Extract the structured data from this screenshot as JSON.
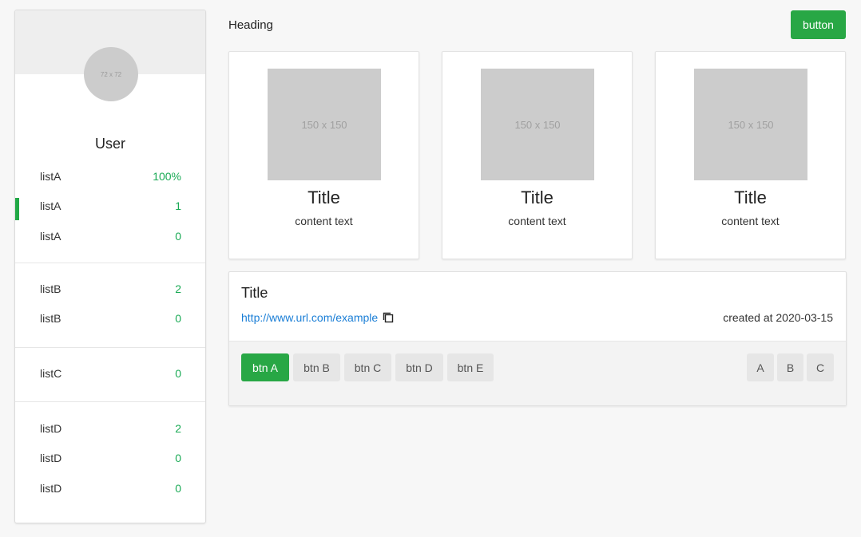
{
  "sidebar": {
    "avatar_placeholder": "72 x 72",
    "username": "User",
    "groups": [
      [
        {
          "label": "listA",
          "value": "100%"
        },
        {
          "label": "listA",
          "value": "1"
        },
        {
          "label": "listA",
          "value": "0"
        }
      ],
      [
        {
          "label": "listB",
          "value": "2"
        },
        {
          "label": "listB",
          "value": "0"
        }
      ],
      [
        {
          "label": "listC",
          "value": "0"
        }
      ],
      [
        {
          "label": "listD",
          "value": "2"
        },
        {
          "label": "listD",
          "value": "0"
        },
        {
          "label": "listD",
          "value": "0"
        }
      ]
    ]
  },
  "header": {
    "heading": "Heading",
    "button_label": "button"
  },
  "cards": [
    {
      "image_placeholder": "150 x 150",
      "title": "Title",
      "text": "content text"
    },
    {
      "image_placeholder": "150 x 150",
      "title": "Title",
      "text": "content text"
    },
    {
      "image_placeholder": "150 x 150",
      "title": "Title",
      "text": "content text"
    }
  ],
  "panel": {
    "title": "Title",
    "url": "http://www.url.com/example",
    "created": "created at 2020-03-15",
    "left_buttons": [
      "btn A",
      "btn B",
      "btn C",
      "btn D",
      "btn E"
    ],
    "right_buttons": [
      "A",
      "B",
      "C"
    ]
  },
  "colors": {
    "accent": "#28a745",
    "value_text": "#1aaa55",
    "link": "#1a7ed6"
  }
}
